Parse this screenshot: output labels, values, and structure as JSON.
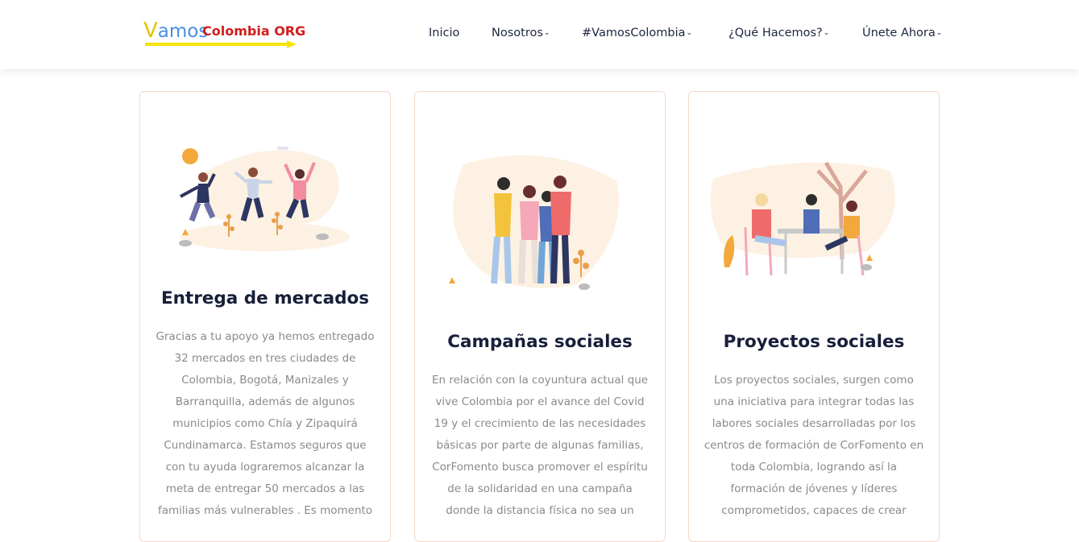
{
  "header": {
    "logo": {
      "vamos_initial": "V",
      "vamos_rest": "amos",
      "org_text": "Colombia ORG"
    },
    "nav": [
      {
        "label": "Inicio",
        "has_dropdown": false
      },
      {
        "label": "Nosotros",
        "has_dropdown": true
      },
      {
        "label": "#VamosColombia",
        "has_dropdown": true
      },
      {
        "label": "¿Qué Hacemos?",
        "has_dropdown": true
      },
      {
        "label": "Únete Ahora",
        "has_dropdown": true
      }
    ]
  },
  "cards": [
    {
      "title": "Entrega de mercados",
      "illustration": "people-jumping-illustration",
      "text": "Gracias a tu apoyo ya hemos entregado 32 mercados en tres ciudades de Colombia, Bogotá, Manizales y Barranquilla, además de algunos municipios como Chía y Zipaquirá Cundinamarca. Estamos seguros que con tu ayuda lograremos alcanzar la meta de entregar 50 mercados a las familias más vulnerables . Es momento"
    },
    {
      "title": "Campañas sociales",
      "illustration": "group-selfie-illustration",
      "text": "En relación con la coyuntura actual que vive Colombia por el avance del Covid 19 y el crecimiento de las necesidades básicas por parte de algunas familias, CorFomento busca promover el espíritu de la solidaridad en una campaña donde la distancia física no sea un"
    },
    {
      "title": "Proyectos sociales",
      "illustration": "people-at-table-illustration",
      "text": "Los proyectos sociales, surgen como una iniciativa para integrar todas las labores sociales desarrolladas por los centros de formación de CorFomento en toda Colombia, logrando así la formación de jóvenes y líderes comprometidos, capaces de crear"
    }
  ],
  "colors": {
    "nav_text": "#1c2541",
    "title_text": "#171f3a",
    "body_text": "#8a8a8a",
    "card_border": "#f6d6cc",
    "illustration_accent": "#f3a83b",
    "illustration_blob": "#fdf1e3"
  }
}
